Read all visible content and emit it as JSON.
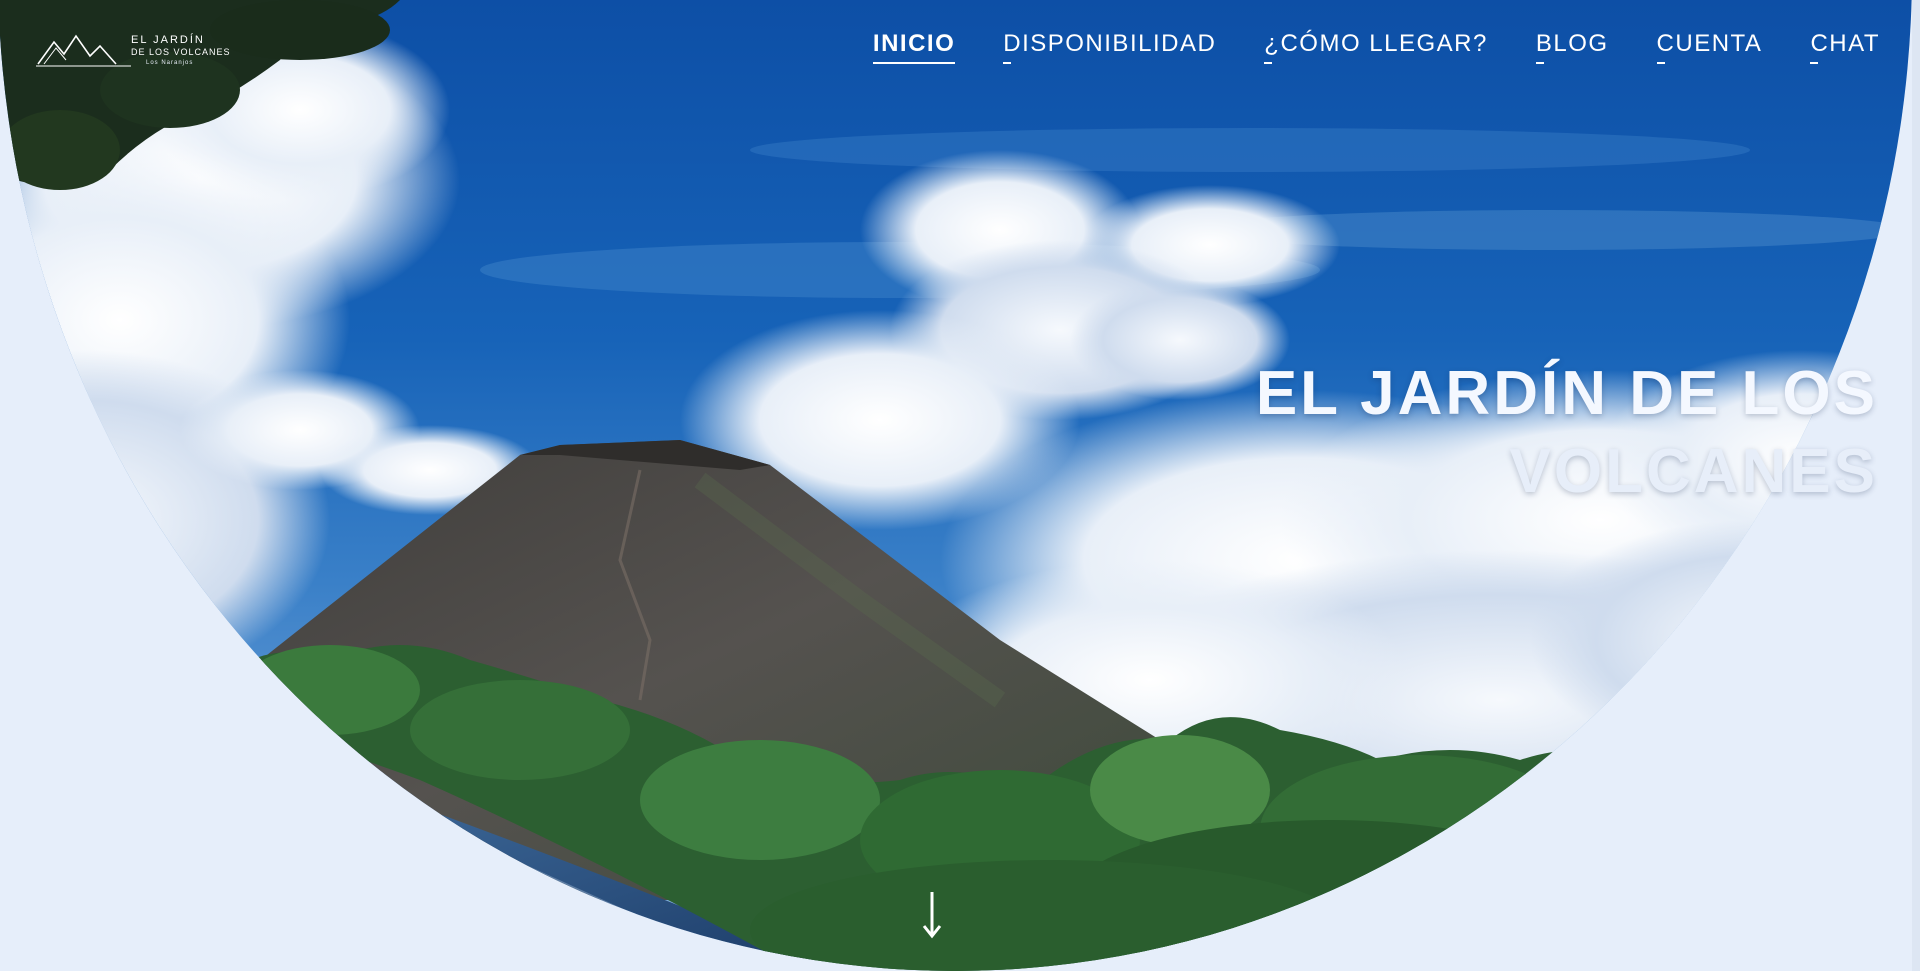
{
  "logo": {
    "line1": "EL JARDÍN",
    "line2": "DE LOS VOLCANES",
    "line3": "Los Naranjos"
  },
  "nav": {
    "items": [
      {
        "label": "INICIO",
        "active": true
      },
      {
        "label": "DISPONIBILIDAD",
        "active": false
      },
      {
        "label": "¿CÓMO LLEGAR?",
        "active": false
      },
      {
        "label": "BLOG",
        "active": false
      },
      {
        "label": "CUENTA",
        "active": false
      },
      {
        "label": "CHAT",
        "active": false
      }
    ]
  },
  "hero": {
    "title_line1": "EL JARDÍN DE LOS",
    "title_line2": "VOLCANES",
    "scroll_icon": "arrow-down-icon"
  },
  "colors": {
    "sky": "#1a5fb0",
    "cloud": "#eef3fa",
    "volcano": "#4a4a48",
    "foliage": "#2e6b34",
    "page_bg": "#e6eefa",
    "text": "#ffffff"
  }
}
